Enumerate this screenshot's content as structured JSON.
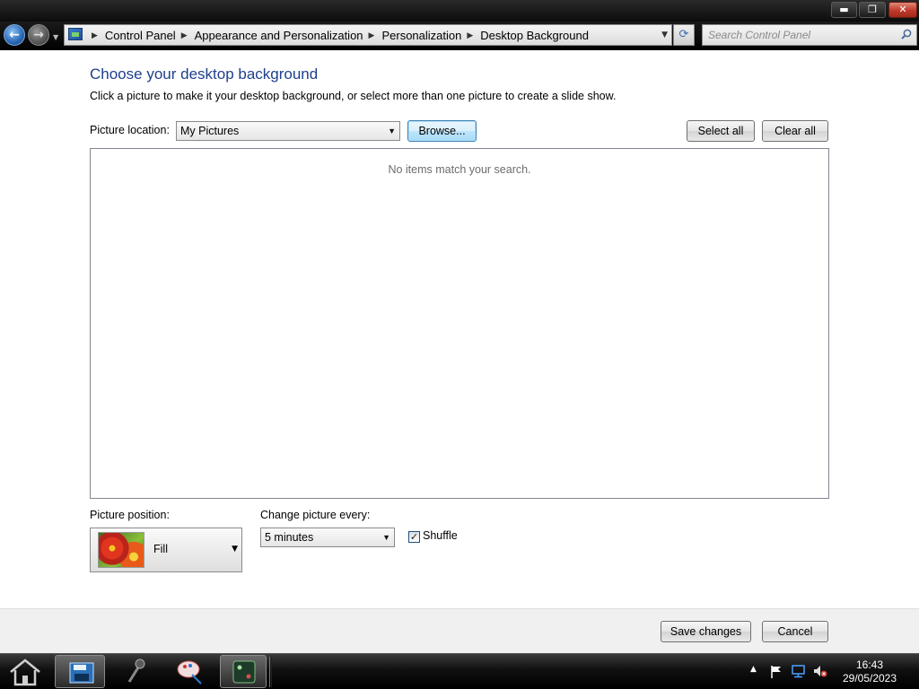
{
  "window": {
    "minimize_label": "▬",
    "restore_label": "❐",
    "close_label": "✕"
  },
  "address_bar": {
    "breadcrumbs": [
      {
        "label": "Control Panel"
      },
      {
        "label": "Appearance and Personalization"
      },
      {
        "label": "Personalization"
      },
      {
        "label": "Desktop Background"
      }
    ]
  },
  "search": {
    "placeholder": "Search Control Panel"
  },
  "page": {
    "title": "Choose your desktop background",
    "description": "Click a picture to make it your desktop background, or select more than one picture to create a slide show."
  },
  "picture_location": {
    "label": "Picture location:",
    "selected": "My Pictures",
    "browse_label": "Browse...",
    "select_all_label": "Select all",
    "clear_all_label": "Clear all"
  },
  "picture_list": {
    "empty_message": "No items match your search."
  },
  "picture_position": {
    "label": "Picture position:",
    "selected": "Fill"
  },
  "change_picture": {
    "label": "Change picture every:",
    "selected": "5 minutes",
    "shuffle_label": "Shuffle",
    "shuffle_checked": true
  },
  "footer": {
    "save_label": "Save changes",
    "cancel_label": "Cancel"
  },
  "taskbar": {
    "time": "16:43",
    "date": "29/05/2023"
  }
}
